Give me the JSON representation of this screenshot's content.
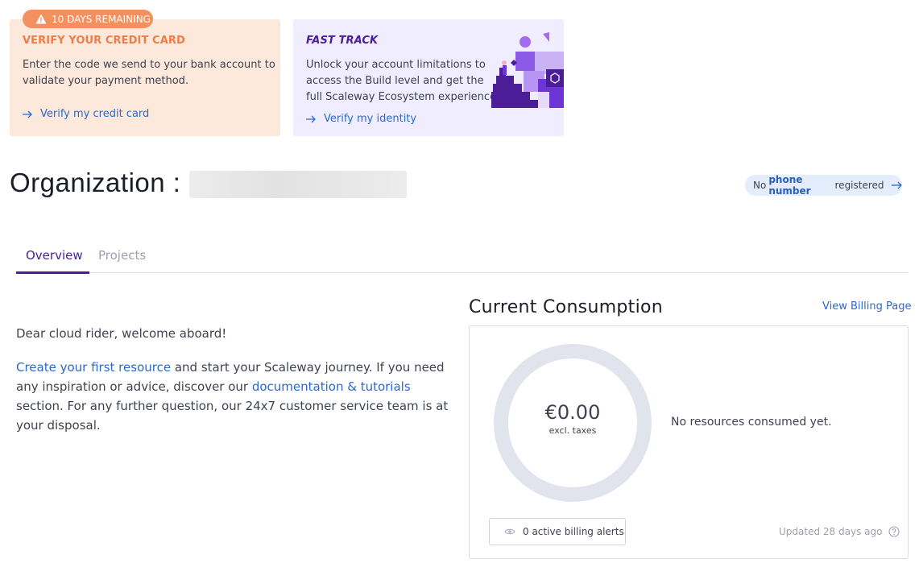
{
  "banners": {
    "credit": {
      "badge": "10 DAYS REMAINING",
      "title": "VERIFY YOUR CREDIT CARD",
      "text_line1": "Enter the code we send to your bank account to",
      "text_line2": "validate your payment method.",
      "link": "Verify my credit card"
    },
    "fast_track": {
      "title": "FAST TRACK",
      "text_line1": "Unlock your account limitations to",
      "text_line2": "access the Build level and get the",
      "text_line3": "full Scaleway Ecosystem experience!",
      "link": "Verify my identity"
    }
  },
  "org": {
    "title": "Organization :",
    "phone_pill": {
      "prefix": "No",
      "emphasis": "phone number",
      "suffix": "registered"
    }
  },
  "tabs": [
    {
      "label": "Overview",
      "active": true
    },
    {
      "label": "Projects",
      "active": false
    }
  ],
  "welcome": {
    "greeting": "Dear cloud rider, welcome aboard!",
    "link1": "Create your first resource",
    "text1": " and start your Scaleway journey. If you need any inspiration or advice, discover our ",
    "link2": "documentation & tutorials",
    "text2": " section. For any further question, our 24x7 customer service team is at your disposal."
  },
  "consumption": {
    "title": "Current Consumption",
    "billing_link": "View Billing Page",
    "amount": "€0.00",
    "amount_note": "excl. taxes",
    "status": "No resources consumed yet.",
    "alerts_button": "0 active billing alerts",
    "updated": "Updated 28 days ago"
  },
  "colors": {
    "accent": "#4b1d97",
    "link": "#2b6ac9",
    "credit_bg": "#fde8dc",
    "credit_badge": "#f3905f",
    "fast_bg": "#efedff",
    "donut_track": "#e1e4ed"
  }
}
